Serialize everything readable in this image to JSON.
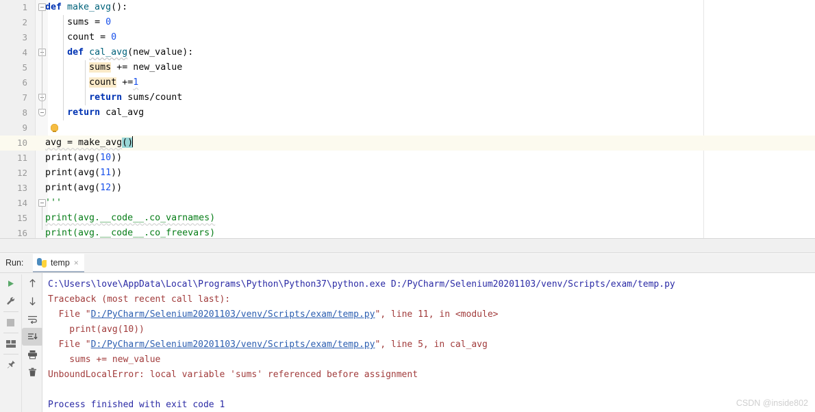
{
  "editor": {
    "lines": [
      {
        "n": "1",
        "indent": 0,
        "fold": "start",
        "segs": [
          {
            "t": "def ",
            "c": "kw"
          },
          {
            "t": "make_avg",
            "c": "fnd"
          },
          {
            "t": "():",
            "c": "pln"
          }
        ]
      },
      {
        "n": "2",
        "indent": 1,
        "segs": [
          {
            "t": "sums = ",
            "c": "pln"
          },
          {
            "t": "0",
            "c": "num"
          }
        ]
      },
      {
        "n": "3",
        "indent": 1,
        "segs": [
          {
            "t": "count = ",
            "c": "pln"
          },
          {
            "t": "0",
            "c": "num"
          }
        ]
      },
      {
        "n": "4",
        "indent": 1,
        "fold": "start",
        "segs": [
          {
            "t": "def ",
            "c": "kw"
          },
          {
            "t": "cal_avg",
            "c": "fnd unused"
          },
          {
            "t": "(new_value):",
            "c": "pln"
          }
        ]
      },
      {
        "n": "5",
        "indent": 2,
        "segs": [
          {
            "t": "sums",
            "c": "pln hl-var"
          },
          {
            "t": " += new_value",
            "c": "pln"
          }
        ]
      },
      {
        "n": "6",
        "indent": 2,
        "segs": [
          {
            "t": "count",
            "c": "pln hl-var"
          },
          {
            "t": " +=",
            "c": "pln"
          },
          {
            "t": "1",
            "c": "num weak-wave"
          }
        ]
      },
      {
        "n": "7",
        "indent": 2,
        "fold": "end",
        "segs": [
          {
            "t": "return ",
            "c": "kw"
          },
          {
            "t": "sums/count",
            "c": "pln"
          }
        ]
      },
      {
        "n": "8",
        "indent": 1,
        "fold": "end",
        "segs": [
          {
            "t": "return ",
            "c": "kw"
          },
          {
            "t": "cal_avg",
            "c": "pln"
          }
        ]
      },
      {
        "n": "9",
        "indent": 0,
        "bulb": true,
        "segs": []
      },
      {
        "n": "10",
        "indent": 0,
        "caret": true,
        "segs": [
          {
            "t": "avg = make_avg",
            "c": "pln weak-wave"
          },
          {
            "t": "()",
            "c": "pln brace-hl"
          },
          {
            "t": "|CARET|",
            "c": "caret"
          }
        ]
      },
      {
        "n": "11",
        "indent": 0,
        "segs": [
          {
            "t": "print(avg(",
            "c": "pln"
          },
          {
            "t": "10",
            "c": "num"
          },
          {
            "t": "))",
            "c": "pln"
          }
        ]
      },
      {
        "n": "12",
        "indent": 0,
        "segs": [
          {
            "t": "print(avg(",
            "c": "pln"
          },
          {
            "t": "11",
            "c": "num"
          },
          {
            "t": "))",
            "c": "pln"
          }
        ]
      },
      {
        "n": "13",
        "indent": 0,
        "segs": [
          {
            "t": "print(avg(",
            "c": "pln"
          },
          {
            "t": "12",
            "c": "num"
          },
          {
            "t": "))",
            "c": "pln"
          }
        ]
      },
      {
        "n": "14",
        "indent": 0,
        "fold": "start",
        "segs": [
          {
            "t": "'''",
            "c": "str"
          }
        ]
      },
      {
        "n": "15",
        "indent": 0,
        "segs": [
          {
            "t": "print(avg.__code__.co_varnames)",
            "c": "str weak-wave"
          }
        ]
      },
      {
        "n": "16",
        "indent": 0,
        "segs": [
          {
            "t": "print(avg.__code__.co_freevars)",
            "c": "str"
          }
        ]
      }
    ]
  },
  "run_panel": {
    "run_label": "Run:",
    "tab_name": "temp",
    "tab_close": "×",
    "toolbar_left": [
      {
        "name": "rerun-button",
        "icon": "play-icon"
      },
      {
        "name": "settings-button",
        "icon": "wrench-icon"
      },
      {
        "name": "stop-button",
        "icon": "stop-icon"
      },
      {
        "name": "layout-button",
        "icon": "layout-icon"
      },
      {
        "name": "pin-tab-button",
        "icon": "pin-icon"
      }
    ],
    "toolbar_right": [
      {
        "name": "up-button",
        "icon": "arrow-up-icon"
      },
      {
        "name": "down-button",
        "icon": "arrow-down-icon"
      },
      {
        "name": "soft-wrap-button",
        "icon": "wrap-icon"
      },
      {
        "name": "scroll-to-end-button",
        "icon": "scroll-end-icon",
        "active": true
      },
      {
        "name": "print-button",
        "icon": "printer-icon"
      },
      {
        "name": "clear-all-button",
        "icon": "trash-icon"
      }
    ],
    "console": [
      {
        "type": "cmd",
        "text": "C:\\Users\\love\\AppData\\Local\\Programs\\Python\\Python37\\python.exe D:/PyCharm/Selenium20201103/venv/Scripts/exam/temp.py"
      },
      {
        "type": "err",
        "text": "Traceback (most recent call last):"
      },
      {
        "type": "err-link",
        "pre": "  File \"",
        "link": "D:/PyCharm/Selenium20201103/venv/Scripts/exam/temp.py",
        "post": "\", line 11, in <module>"
      },
      {
        "type": "err",
        "text": "    print(avg(10))"
      },
      {
        "type": "err-link",
        "pre": "  File \"",
        "link": "D:/PyCharm/Selenium20201103/venv/Scripts/exam/temp.py",
        "post": "\", line 5, in cal_avg"
      },
      {
        "type": "err",
        "text": "    sums += new_value"
      },
      {
        "type": "err",
        "text": "UnboundLocalError: local variable 'sums' referenced before assignment"
      },
      {
        "type": "blank",
        "text": ""
      },
      {
        "type": "done",
        "text": "Process finished with exit code 1"
      }
    ]
  },
  "watermark": "CSDN @inside802",
  "colors": {
    "keyword": "#0033b3",
    "function_def": "#00627a",
    "number": "#1750eb",
    "string": "#067d17",
    "highlight_var": "#faeac8",
    "brace_match": "#99d6d6",
    "caret_row": "#fcfaef",
    "console_cmd": "#2a2aa5",
    "console_error": "#a13b3b",
    "console_link": "#2a5db0"
  }
}
